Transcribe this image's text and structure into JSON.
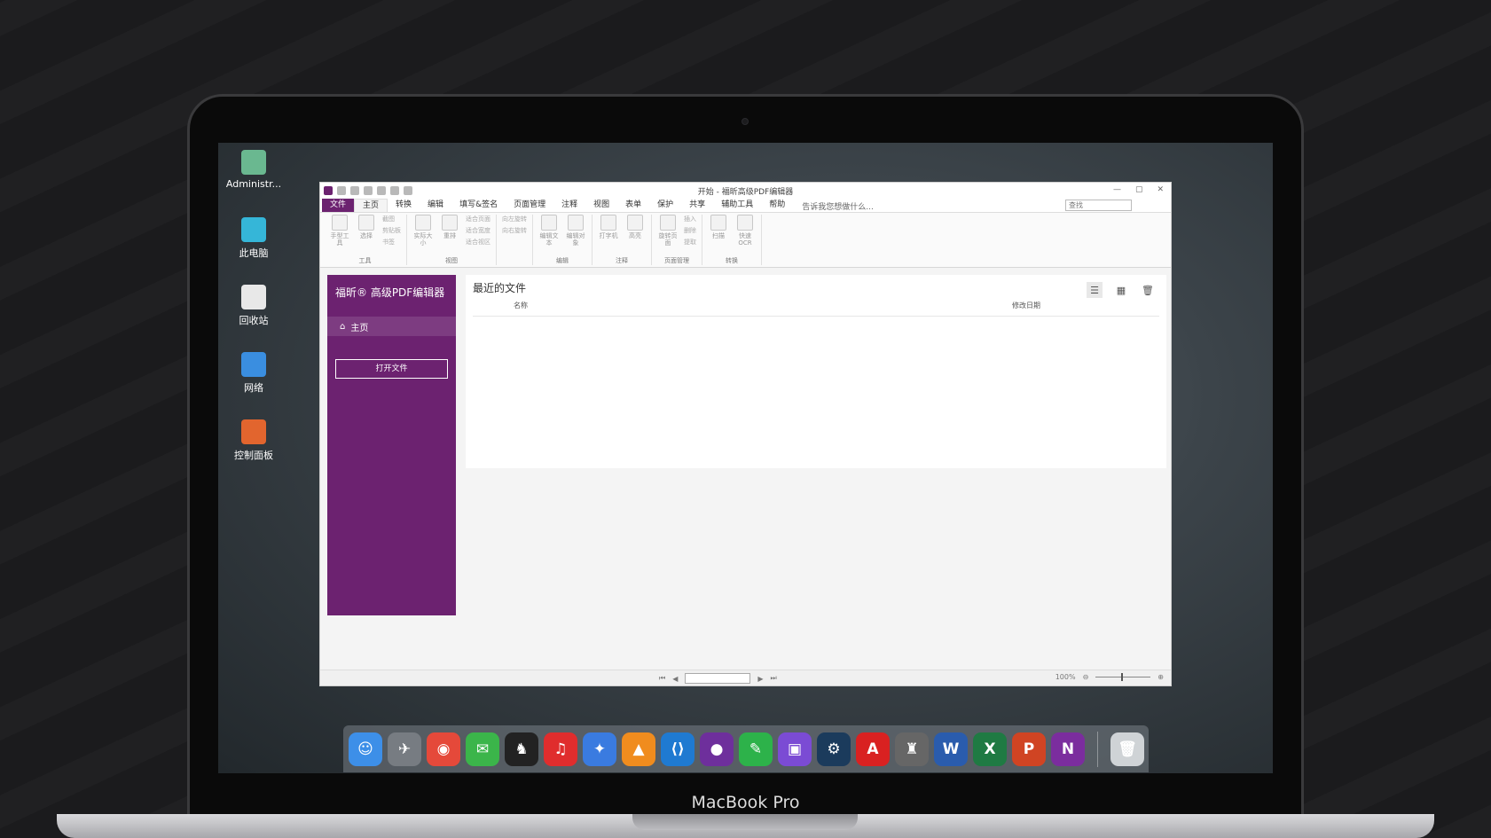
{
  "desktop": {
    "icons": [
      {
        "label": "Administr...",
        "color": "#6ab890"
      },
      {
        "label": "此电脑",
        "color": "#35b6d8"
      },
      {
        "label": "回收站",
        "color": "#e8e8e8"
      },
      {
        "label": "网络",
        "color": "#3a8ee0"
      },
      {
        "label": "控制面板",
        "color": "#e2652e"
      }
    ]
  },
  "app": {
    "window_title": "开始 - 福昕高级PDF编辑器",
    "menu": [
      "文件",
      "主页",
      "转换",
      "编辑",
      "填写&签名",
      "页面管理",
      "注释",
      "视图",
      "表单",
      "保护",
      "共享",
      "辅助工具",
      "帮助"
    ],
    "tell_me": "告诉我您想做什么...",
    "search_placeholder": "查找",
    "ribbon": {
      "groups": [
        {
          "label": "工具",
          "buttons": [
            "手型工具",
            "选择"
          ],
          "small": [
            "截图",
            "剪贴板",
            "书签"
          ]
        },
        {
          "label": "视图",
          "buttons": [
            "实际大小",
            "重排"
          ],
          "small": [
            "适合页面",
            "适合宽度",
            "适合视区"
          ]
        },
        {
          "label": "",
          "buttons": [],
          "small": [
            "向左旋转",
            "向右旋转"
          ]
        },
        {
          "label": "编辑",
          "buttons": [
            "编辑文本",
            "编辑对象"
          ],
          "small": []
        },
        {
          "label": "注释",
          "buttons": [
            "打字机",
            "高亮"
          ],
          "small": []
        },
        {
          "label": "页面管理",
          "buttons": [
            "旋转页面"
          ],
          "small": [
            "插入",
            "删除",
            "提取"
          ]
        },
        {
          "label": "转换",
          "buttons": [
            "扫描",
            "快速OCR"
          ],
          "small": []
        }
      ]
    },
    "sidebar": {
      "title": "福昕® 高级PDF编辑器",
      "home": "主页",
      "open_file": "打开文件"
    },
    "recent": {
      "title": "最近的文件",
      "col_name": "名称",
      "col_date": "修改日期"
    },
    "status": {
      "zoom": "100%"
    }
  },
  "dock": [
    {
      "name": "finder",
      "color": "#3d8fe8",
      "glyph": "☺"
    },
    {
      "name": "launchpad",
      "color": "#777c82",
      "glyph": "✈"
    },
    {
      "name": "chrome",
      "color": "#e5493a",
      "glyph": "◉"
    },
    {
      "name": "wechat",
      "color": "#3bb54a",
      "glyph": "✉"
    },
    {
      "name": "qq",
      "color": "#222222",
      "glyph": "♞"
    },
    {
      "name": "netease-music",
      "color": "#e02d2d",
      "glyph": "♫"
    },
    {
      "name": "feishu",
      "color": "#3a7be0",
      "glyph": "✦"
    },
    {
      "name": "vlc",
      "color": "#f08c1e",
      "glyph": "▲"
    },
    {
      "name": "vscode",
      "color": "#1f7ad1",
      "glyph": "⟨⟩"
    },
    {
      "name": "github",
      "color": "#6e2f9c",
      "glyph": "●"
    },
    {
      "name": "evernote",
      "color": "#2db24a",
      "glyph": "✎"
    },
    {
      "name": "twitch",
      "color": "#7b4bd4",
      "glyph": "▣"
    },
    {
      "name": "steam",
      "color": "#1b3b5c",
      "glyph": "⚙"
    },
    {
      "name": "acrobat",
      "color": "#d92121",
      "glyph": "A"
    },
    {
      "name": "rhino",
      "color": "#666666",
      "glyph": "♜"
    },
    {
      "name": "word",
      "color": "#2a5cad",
      "glyph": "W"
    },
    {
      "name": "excel",
      "color": "#1f7a43",
      "glyph": "X"
    },
    {
      "name": "powerpoint",
      "color": "#d04423",
      "glyph": "P"
    },
    {
      "name": "onenote",
      "color": "#7b2d9e",
      "glyph": "N"
    },
    {
      "name": "trash",
      "color": "#cfd3d6",
      "glyph": "🗑"
    }
  ],
  "laptop": {
    "brand": "MacBook Pro"
  }
}
